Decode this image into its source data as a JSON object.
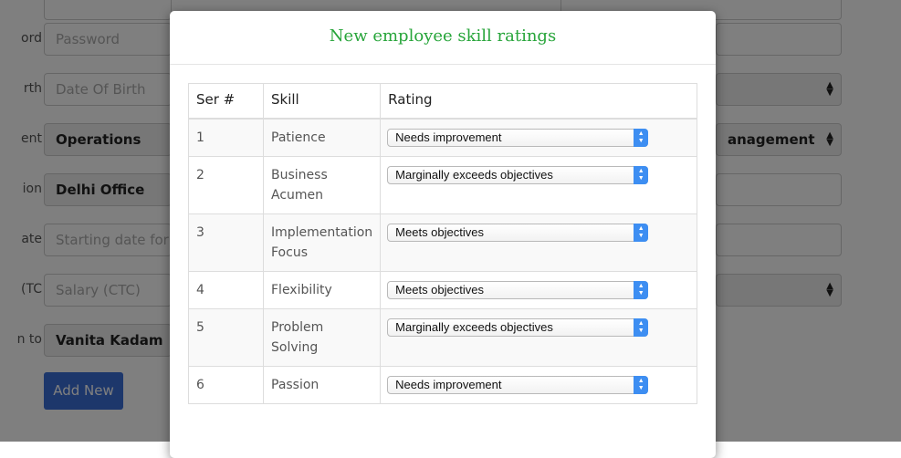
{
  "background_form": {
    "labels": [
      "ord",
      "rth",
      "ent",
      "ion",
      "ate",
      "TC)",
      "n to"
    ],
    "password_placeholder": "Password",
    "dob_placeholder": "Date Of Birth",
    "department_value": "Operations",
    "location_value": "Delhi Office",
    "start_date_placeholder": "Starting date for",
    "salary_placeholder": "Salary (CTC)",
    "reports_to_value": "Vanita Kadam",
    "right_select_value": "anagement",
    "add_new_label": "Add New"
  },
  "modal": {
    "title": "New employee skill ratings",
    "columns": [
      "Ser #",
      "Skill",
      "Rating"
    ],
    "rows": [
      {
        "ser": "1",
        "skill": "Patience",
        "rating": "Needs improvement"
      },
      {
        "ser": "2",
        "skill": "Business Acumen",
        "rating": "Marginally exceeds objectives"
      },
      {
        "ser": "3",
        "skill": "Implementation Focus",
        "rating": "Meets objectives"
      },
      {
        "ser": "4",
        "skill": "Flexibility",
        "rating": "Meets objectives"
      },
      {
        "ser": "5",
        "skill": "Problem Solving",
        "rating": "Marginally exceeds objectives"
      },
      {
        "ser": "6",
        "skill": "Passion",
        "rating": "Needs improvement"
      }
    ]
  },
  "icons": {
    "select_arrows": "updown-arrows-icon"
  },
  "colors": {
    "title_green": "#27a53a",
    "button_blue": "#3b6fd6",
    "select_arrow_blue": "#3d8ef2"
  }
}
